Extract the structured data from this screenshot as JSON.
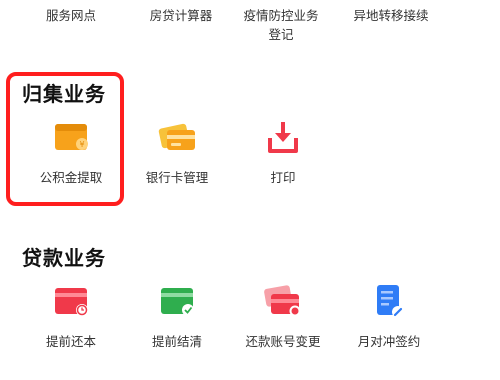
{
  "top_row": [
    {
      "label": "服务网点"
    },
    {
      "label": "房贷计算器"
    },
    {
      "label": "疫情防控业务\n登记"
    },
    {
      "label": "异地转移接续"
    }
  ],
  "guiji": {
    "title": "归集业务",
    "items": [
      {
        "label": "公积金提取",
        "icon": "wallet-icon"
      },
      {
        "label": "银行卡管理",
        "icon": "bank-card-icon"
      },
      {
        "label": "打印",
        "icon": "download-print-icon"
      }
    ]
  },
  "daikuan": {
    "title": "贷款业务",
    "items": [
      {
        "label": "提前还本",
        "icon": "card-clock-icon"
      },
      {
        "label": "提前结清",
        "icon": "card-check-icon"
      },
      {
        "label": "还款账号变更",
        "icon": "cards-exchange-icon"
      },
      {
        "label": "月对冲签约",
        "icon": "document-pen-icon"
      }
    ]
  },
  "colors": {
    "highlight": "#ff1e1e",
    "orange": "#f7a21b",
    "red": "#f0394a",
    "green": "#2fae4e",
    "blue": "#2f7cf6"
  }
}
